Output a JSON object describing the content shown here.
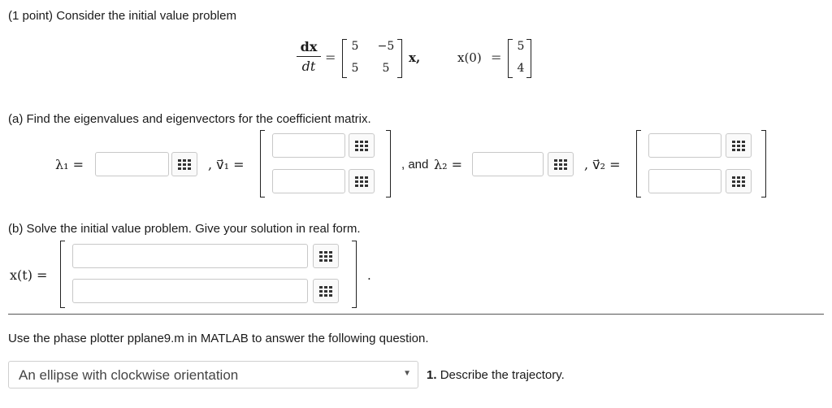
{
  "intro": "(1 point) Consider the initial value problem",
  "ode": {
    "lhs_num": "dx",
    "lhs_den": "dt",
    "eq": "=",
    "matrix": [
      "5",
      "−5",
      "5",
      "5"
    ],
    "vec_suffix": "x,",
    "ic_label": "x(0)",
    "ic_eq": "=",
    "ic_vec": [
      "5",
      "4"
    ]
  },
  "part_a": {
    "prompt": "(a) Find the eigenvalues and eigenvectors for the coefficient matrix.",
    "lambda1_label": "λ₁ =",
    "v1_label": ", v⃗₁ =",
    "and_text": ", and",
    "lambda2_label": "λ₂ =",
    "v2_label": ", v⃗₂ ="
  },
  "part_b": {
    "prompt": "(b) Solve the initial value problem. Give your solution in real form.",
    "xt_label": "x(t) =",
    "period": "."
  },
  "phase": {
    "prompt": "Use the phase plotter pplane9.m in MATLAB to answer the following question.",
    "selected": "An ellipse with clockwise orientation",
    "question_num": "1.",
    "question_text": "Describe the trajectory."
  },
  "icons": {
    "palette": "equation-palette-icon",
    "dropdown": "chevron-down-icon"
  }
}
